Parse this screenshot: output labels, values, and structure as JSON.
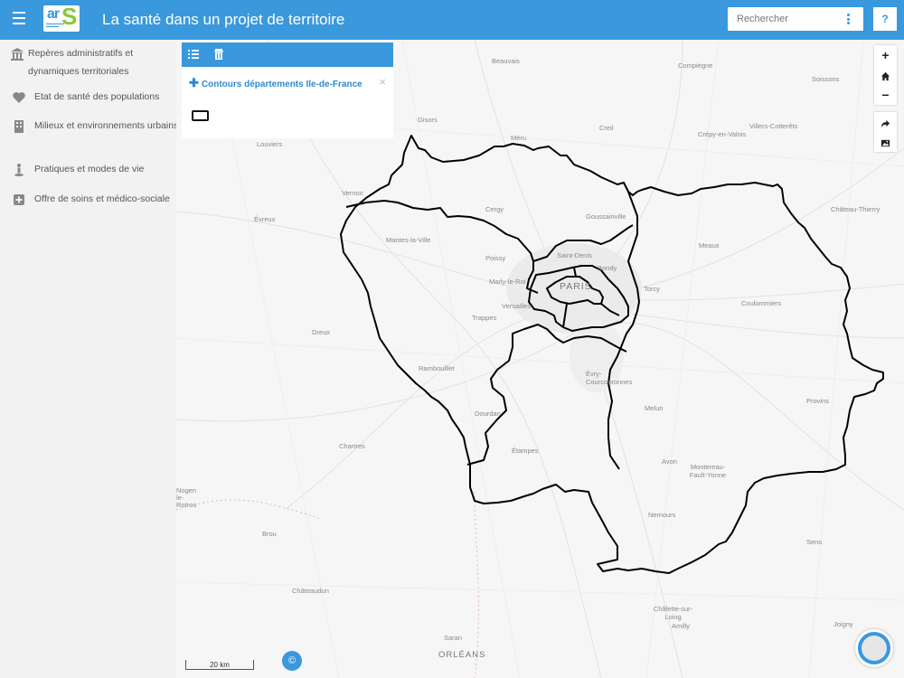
{
  "header": {
    "title": "La santé dans un projet de territoire",
    "search_placeholder": "Rechercher",
    "help_label": "?"
  },
  "sidebar": {
    "items": [
      {
        "label": "Repères administratifs et dynamiques territoriales",
        "icon": "institution-icon"
      },
      {
        "label": "Etat de santé des populations",
        "icon": "heart-icon"
      },
      {
        "label": "Milieux et environnements urbains",
        "icon": "building-icon"
      },
      {
        "label": "Pratiques et modes de vie",
        "icon": "person-icon"
      },
      {
        "label": "Offre de soins et médico-sociale",
        "icon": "plus-square-icon"
      }
    ]
  },
  "layer_panel": {
    "layer_name": "Contours départements Ile-de-France",
    "close_label": "×"
  },
  "map": {
    "places": [
      {
        "name": "Beauvais"
      },
      {
        "name": "Compiègne"
      },
      {
        "name": "Soissons"
      },
      {
        "name": "Gisors"
      },
      {
        "name": "Méru"
      },
      {
        "name": "Creil"
      },
      {
        "name": "Crépy-en-Valois"
      },
      {
        "name": "Villers-Cotterêts"
      },
      {
        "name": "Louviers"
      },
      {
        "name": "Vernon"
      },
      {
        "name": "Évreux"
      },
      {
        "name": "Cergy"
      },
      {
        "name": "Goussainville"
      },
      {
        "name": "Château-Thierry"
      },
      {
        "name": "Mantes-la-Ville"
      },
      {
        "name": "Saint-Denis"
      },
      {
        "name": "Meaux"
      },
      {
        "name": "Poissy"
      },
      {
        "name": "Bondy"
      },
      {
        "name": "PARIS"
      },
      {
        "name": "Marly-le-Roi"
      },
      {
        "name": "Torcy"
      },
      {
        "name": "Versailles"
      },
      {
        "name": "Coulommiers"
      },
      {
        "name": "Trappes"
      },
      {
        "name": "Dreux"
      },
      {
        "name": "Rambouillet"
      },
      {
        "name": "Évry-Courcouronnes"
      },
      {
        "name": "Provins"
      },
      {
        "name": "Dourdan"
      },
      {
        "name": "Melun"
      },
      {
        "name": "Chartres"
      },
      {
        "name": "Étampes"
      },
      {
        "name": "Avon"
      },
      {
        "name": "Montereau-Fault-Yonne"
      },
      {
        "name": "Nemours"
      },
      {
        "name": "Sens"
      },
      {
        "name": "Brou"
      },
      {
        "name": "Châteaudun"
      },
      {
        "name": "Châlette-sur-Loing"
      },
      {
        "name": "Amilly"
      },
      {
        "name": "Saran"
      },
      {
        "name": "ORLÉANS"
      },
      {
        "name": "Joigny"
      },
      {
        "name": "Nogent-le-Rotrou"
      }
    ],
    "scale_label": "20 km",
    "credit_label": "©"
  },
  "colors": {
    "header": "#3a98dc",
    "accent": "#2e8ad0",
    "boundary": "#000000"
  }
}
